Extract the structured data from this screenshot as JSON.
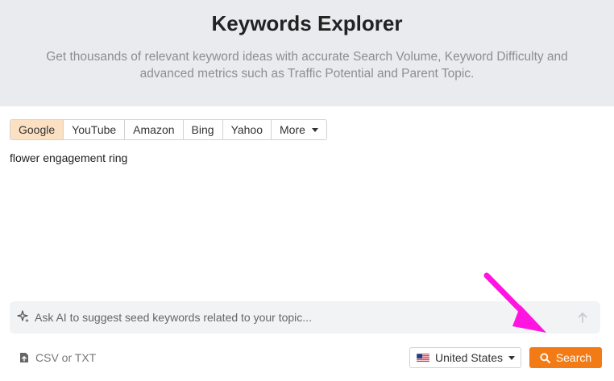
{
  "header": {
    "title": "Keywords Explorer",
    "subtitle": "Get thousands of relevant keyword ideas with accurate Search Volume, Keyword Difficulty and advanced metrics such as Traffic Potential and Parent Topic."
  },
  "engines": {
    "tabs": [
      "Google",
      "YouTube",
      "Amazon",
      "Bing",
      "Yahoo"
    ],
    "more_label": "More",
    "active": "Google"
  },
  "keywords": {
    "value": "flower engagement ring"
  },
  "ai": {
    "placeholder": "Ask AI to suggest seed keywords related to your topic..."
  },
  "footer": {
    "upload_label": "CSV or TXT",
    "country": "United States",
    "search_label": "Search"
  },
  "colors": {
    "accent": "#f37b15",
    "active_tab_bg": "#fbe0c2",
    "annotation_arrow": "#ff14e0"
  }
}
